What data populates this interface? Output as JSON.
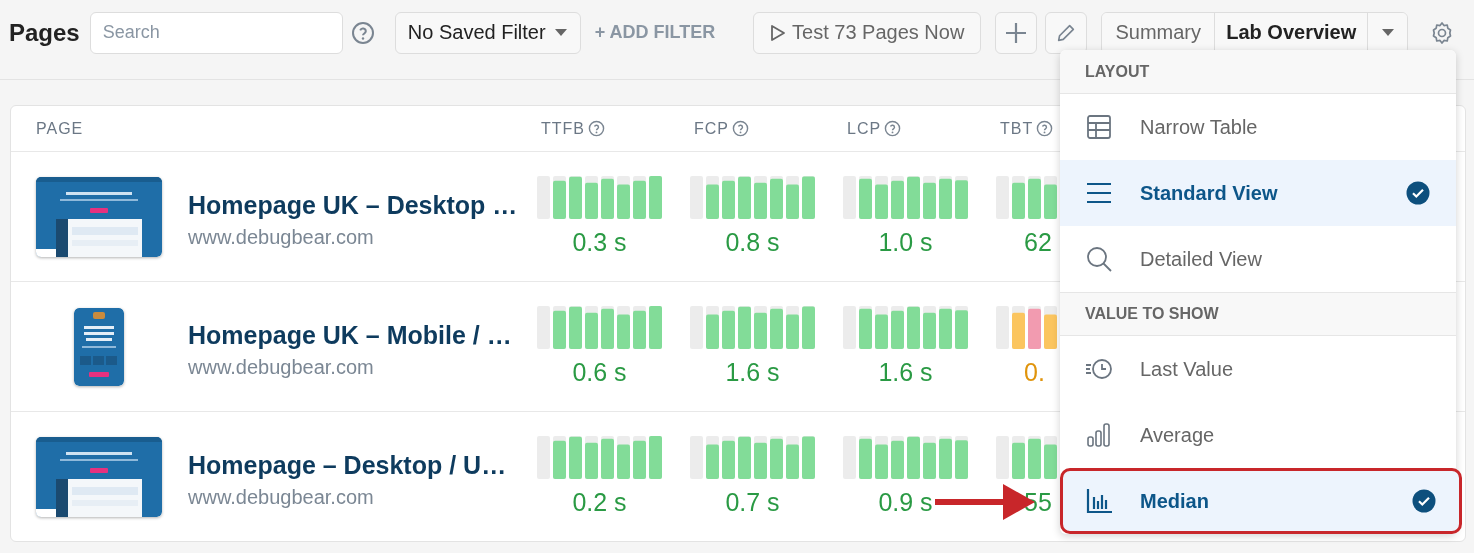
{
  "toolbar": {
    "title": "Pages",
    "search": {
      "placeholder": "Search"
    },
    "saved_filter": "No Saved Filter",
    "add_filter": "+ ADD FILTER",
    "test_button": "Test 73 Pages Now",
    "view_tabs": [
      {
        "label": "Summary",
        "selected": false
      },
      {
        "label": "Lab Overview",
        "selected": true
      }
    ]
  },
  "table": {
    "columns": [
      "PAGE",
      "TTFB",
      "FCP",
      "LCP",
      "TBT"
    ],
    "rows": [
      {
        "title": "Homepage UK – Desktop …",
        "url": "www.debugbear.com",
        "kind": "landscape",
        "metrics": [
          {
            "value": "0.3 s",
            "color": "#2a9a44"
          },
          {
            "value": "0.8 s",
            "color": "#2a9a44"
          },
          {
            "value": "1.0 s",
            "color": "#2a9a44"
          },
          {
            "value": "62",
            "color": "#2a9a44"
          }
        ]
      },
      {
        "title": "Homepage UK – Mobile / …",
        "url": "www.debugbear.com",
        "kind": "portrait",
        "metrics": [
          {
            "value": "0.6 s",
            "color": "#2a9a44"
          },
          {
            "value": "1.6 s",
            "color": "#2a9a44"
          },
          {
            "value": "1.6 s",
            "color": "#2a9a44"
          },
          {
            "value": "0.",
            "color": "#e0940c"
          }
        ]
      },
      {
        "title": "Homepage – Desktop / U…",
        "url": "www.debugbear.com",
        "kind": "landscape",
        "metrics": [
          {
            "value": "0.2 s",
            "color": "#2a9a44"
          },
          {
            "value": "0.7 s",
            "color": "#2a9a44"
          },
          {
            "value": "0.9 s",
            "color": "#2a9a44"
          },
          {
            "value": "55",
            "color": "#2a9a44"
          }
        ]
      }
    ]
  },
  "menu": {
    "sections": [
      {
        "heading": "LAYOUT",
        "items": [
          {
            "label": "Narrow Table",
            "selected": false,
            "highlighted": false
          },
          {
            "label": "Standard View",
            "selected": true,
            "highlighted": false
          },
          {
            "label": "Detailed View",
            "selected": false,
            "highlighted": false
          }
        ]
      },
      {
        "heading": "VALUE TO SHOW",
        "items": [
          {
            "label": "Last Value",
            "selected": false,
            "highlighted": false
          },
          {
            "label": "Average",
            "selected": false,
            "highlighted": false
          },
          {
            "label": "Median",
            "selected": true,
            "highlighted": true
          }
        ]
      }
    ]
  },
  "annotation": {
    "arrow": true
  }
}
